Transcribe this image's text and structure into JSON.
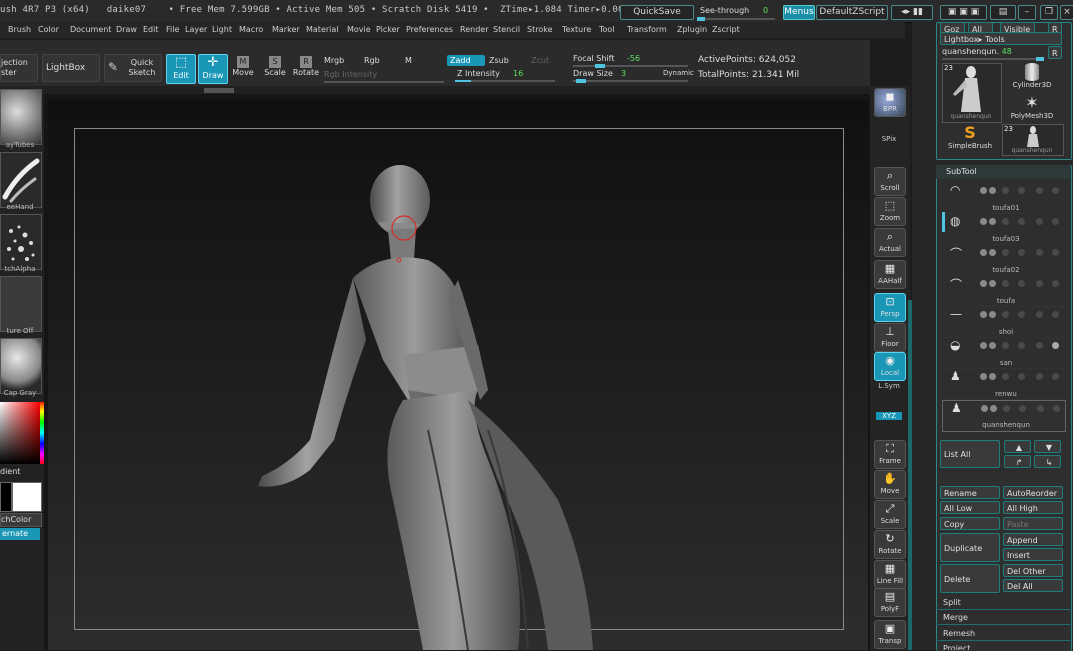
{
  "titlebar": {
    "text": "ush 4R7 P3 (x64)   daike07    • Free Mem 7.599GB • Active Mem 505 • Scratch Disk 5419 •  ZTime▸1.084 Timer▸0.002 • PolyCou",
    "quicksave": "QuickSave",
    "see_through": "See-through",
    "see_through_value": "0",
    "menus": "Menus",
    "default_zscript": "DefaultZScript"
  },
  "menubar": [
    "Brush",
    "Color",
    "Document",
    "Draw",
    "Edit",
    "File",
    "Layer",
    "Light",
    "Macro",
    "Marker",
    "Material",
    "Movie",
    "Picker",
    "Preferences",
    "Render",
    "Stencil",
    "Stroke",
    "Texture",
    "Tool",
    "Transform",
    "Zplugin",
    "Zscript"
  ],
  "toolbar": {
    "projection_master": "jection\nster",
    "lightbox": "LightBox",
    "quick_sketch": "Quick\nSketch",
    "edit": "Edit",
    "draw": "Draw",
    "move": "Move",
    "scale": "Scale",
    "rotate": "Rotate",
    "mrgb": "Mrgb",
    "rgb": "Rgb",
    "m": "M",
    "rgb_intensity": "Rgb Intensity",
    "zadd": "Zadd",
    "zsub": "Zsub",
    "zcut": "Zcut",
    "z_intensity_label": "Z Intensity",
    "z_intensity_value": "16",
    "z_intensity_fraction": 0.16,
    "focal_shift_label": "Focal Shift",
    "focal_shift_value": "-56",
    "draw_size_label": "Draw Size",
    "draw_size_value": "3",
    "dynamic": "Dynamic",
    "active_points": "ActivePoints: 624,052",
    "total_points": "TotalPoints: 21.341 Mil"
  },
  "leftpalette": {
    "items": [
      "ayTubes",
      "eeHand",
      "tchAlpha",
      "ture Off",
      "Cap Gray"
    ],
    "gradient": "dient",
    "switch_color": "chColor",
    "alternate": "ernate"
  },
  "righttools": {
    "labels": [
      "BPR",
      "SPix",
      "Scroll",
      "Zoom",
      "Actual",
      "AAHalf",
      "Persp",
      "Floor",
      "Local",
      "L.Sym",
      "XYZ",
      "Frame",
      "Move",
      "Scale",
      "Rotate",
      "Line Fill",
      "PolyF",
      "Transp"
    ]
  },
  "rightpanel": {
    "top_buttons": [
      "Goz",
      "All",
      "Visible",
      "R"
    ],
    "lightbox_tools": "Lightbox▸ Tools",
    "tool_name": "quanshenqun.",
    "tool_count": "48",
    "r": "R",
    "thumbs": [
      {
        "label": "quanshenqun",
        "badge": "23"
      },
      {
        "label": "Cylinder3D",
        "badge": ""
      },
      {
        "label": "PolyMesh3D",
        "badge": ""
      },
      {
        "label": "SimpleBrush",
        "badge": ""
      },
      {
        "label": "quanshenqun",
        "badge": "23"
      }
    ],
    "subtool_title": "SubTool",
    "subtools": [
      "toufa01",
      "toufa03",
      "toufa02",
      "toufa",
      "shoi",
      "san",
      "renwu",
      "quanshenqun"
    ],
    "list_all": "List All",
    "buttons": {
      "rename": "Rename",
      "autoreorder": "AutoReorder",
      "all_low": "All Low",
      "all_high": "All High",
      "copy": "Copy",
      "paste": "Paste",
      "duplicate": "Duplicate",
      "append": "Append",
      "insert": "Insert",
      "delete": "Delete",
      "del_other": "Del Other",
      "del_all": "Del All",
      "split": "Split",
      "merge": "Merge",
      "remesh": "Remesh",
      "project": "Project"
    }
  },
  "colors": {
    "accent": "#1a97b7",
    "panel_border": "#2a8a8a",
    "background": "#1c1c1c"
  }
}
